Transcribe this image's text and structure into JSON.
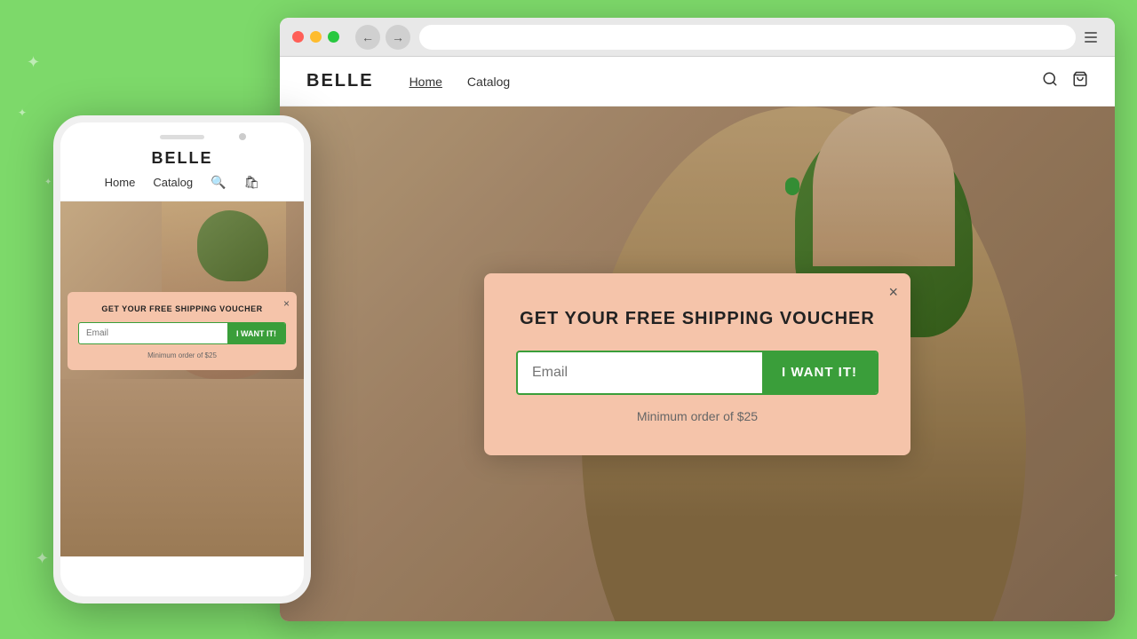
{
  "background": {
    "color": "#7dd96a"
  },
  "browser": {
    "traffic_lights": [
      "red",
      "yellow",
      "green"
    ],
    "address_bar_placeholder": ""
  },
  "website": {
    "logo": "BELLE",
    "nav": {
      "links": [
        {
          "label": "Home",
          "active": true
        },
        {
          "label": "Catalog",
          "active": false
        }
      ]
    }
  },
  "popup": {
    "title": "GET YOUR FREE SHIPPING VOUCHER",
    "email_placeholder": "Email",
    "submit_label": "I WANT IT!",
    "min_order": "Minimum order of $25",
    "close_label": "×"
  },
  "mobile": {
    "logo": "BELLE",
    "nav": {
      "links": [
        {
          "label": "Home"
        },
        {
          "label": "Catalog"
        }
      ]
    },
    "popup": {
      "title": "GET YOUR FREE SHIPPING VOUCHER",
      "email_placeholder": "Email",
      "submit_label": "I WANT IT!",
      "min_order": "Minimum order of $25",
      "close_label": "×"
    }
  }
}
